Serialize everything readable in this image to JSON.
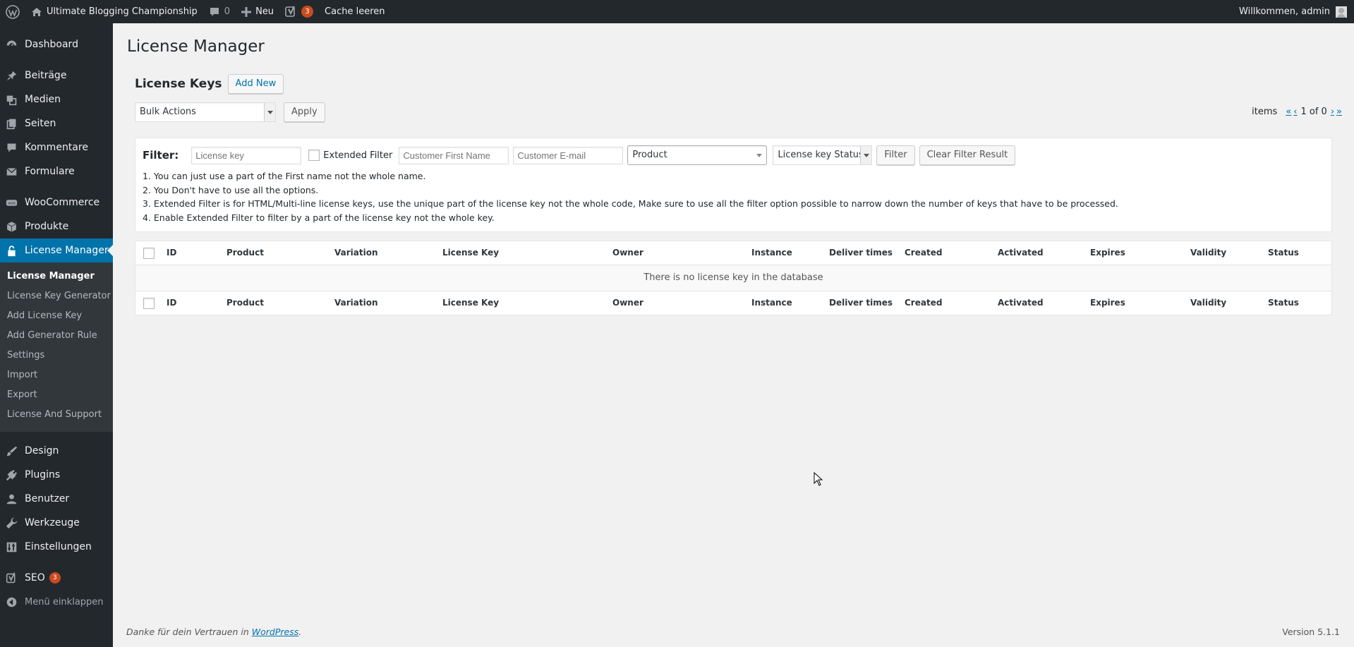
{
  "adminbar": {
    "site_name": "Ultimate Blogging Championship",
    "comments_count": "0",
    "new_label": "Neu",
    "yoast_count": "3",
    "cache_label": "Cache leeren",
    "welcome": "Willkommen, admin"
  },
  "sidebar": {
    "items_top": [
      {
        "label": "Dashboard",
        "icon": "dashboard-icon"
      },
      {
        "label": "Beiträge",
        "icon": "pin-icon"
      },
      {
        "label": "Medien",
        "icon": "media-icon"
      },
      {
        "label": "Seiten",
        "icon": "pages-icon"
      },
      {
        "label": "Kommentare",
        "icon": "comment-icon"
      },
      {
        "label": "Formulare",
        "icon": "mail-icon"
      },
      {
        "label": "WooCommerce",
        "icon": "woo-icon"
      },
      {
        "label": "Produkte",
        "icon": "box-icon"
      },
      {
        "label": "License Manager",
        "icon": "lock-icon"
      }
    ],
    "submenu": [
      "License Manager",
      "License Key Generator",
      "Add License Key",
      "Add Generator Rule",
      "Settings",
      "Import",
      "Export",
      "License And Support"
    ],
    "items_bottom": [
      {
        "label": "Design",
        "icon": "brush-icon"
      },
      {
        "label": "Plugins",
        "icon": "plug-icon"
      },
      {
        "label": "Benutzer",
        "icon": "user-icon"
      },
      {
        "label": "Werkzeuge",
        "icon": "wrench-icon"
      },
      {
        "label": "Einstellungen",
        "icon": "settings-icon"
      },
      {
        "label": "SEO",
        "icon": "yoast-icon",
        "count": "3"
      }
    ],
    "collapse_label": "Menü einklappen"
  },
  "page": {
    "title": "License Manager",
    "section_title": "License Keys",
    "add_new": "Add New",
    "bulk_actions": "Bulk Actions",
    "apply": "Apply",
    "items_label": "items",
    "page_first": "«",
    "page_prev": "‹",
    "page_status": "1 of 0",
    "page_next": "›",
    "page_last": "»"
  },
  "filter": {
    "label": "Filter:",
    "license_key_placeholder": "License key",
    "extended_filter": "Extended Filter",
    "first_name_placeholder": "Customer First Name",
    "email_placeholder": "Customer E-mail",
    "product": "Product",
    "status": "License key Status",
    "filter_button": "Filter",
    "clear_button": "Clear Filter Result",
    "notes": [
      "1. You can just use a part of the First name not the whole name.",
      "2. You Don't have to use all the options.",
      "3. Extended Filter is for HTML/Multi-line license keys, use the unique part of the license key not the whole code, Make sure to use all the filter option possible to narrow down the number of keys that have to be processed.",
      "4. Enable Extended Filter to filter by a part of the license key not the whole key."
    ]
  },
  "table": {
    "columns": [
      "ID",
      "Product",
      "Variation",
      "License Key",
      "Owner",
      "Instance",
      "Deliver times",
      "Created",
      "Activated",
      "Expires",
      "Validity",
      "Status"
    ],
    "empty_message": "There is no license key in the database"
  },
  "footer": {
    "thanks_prefix": "Danke für dein Vertrauen in ",
    "wordpress_link": "WordPress",
    "thanks_suffix": ".",
    "version": "Version 5.1.1"
  }
}
